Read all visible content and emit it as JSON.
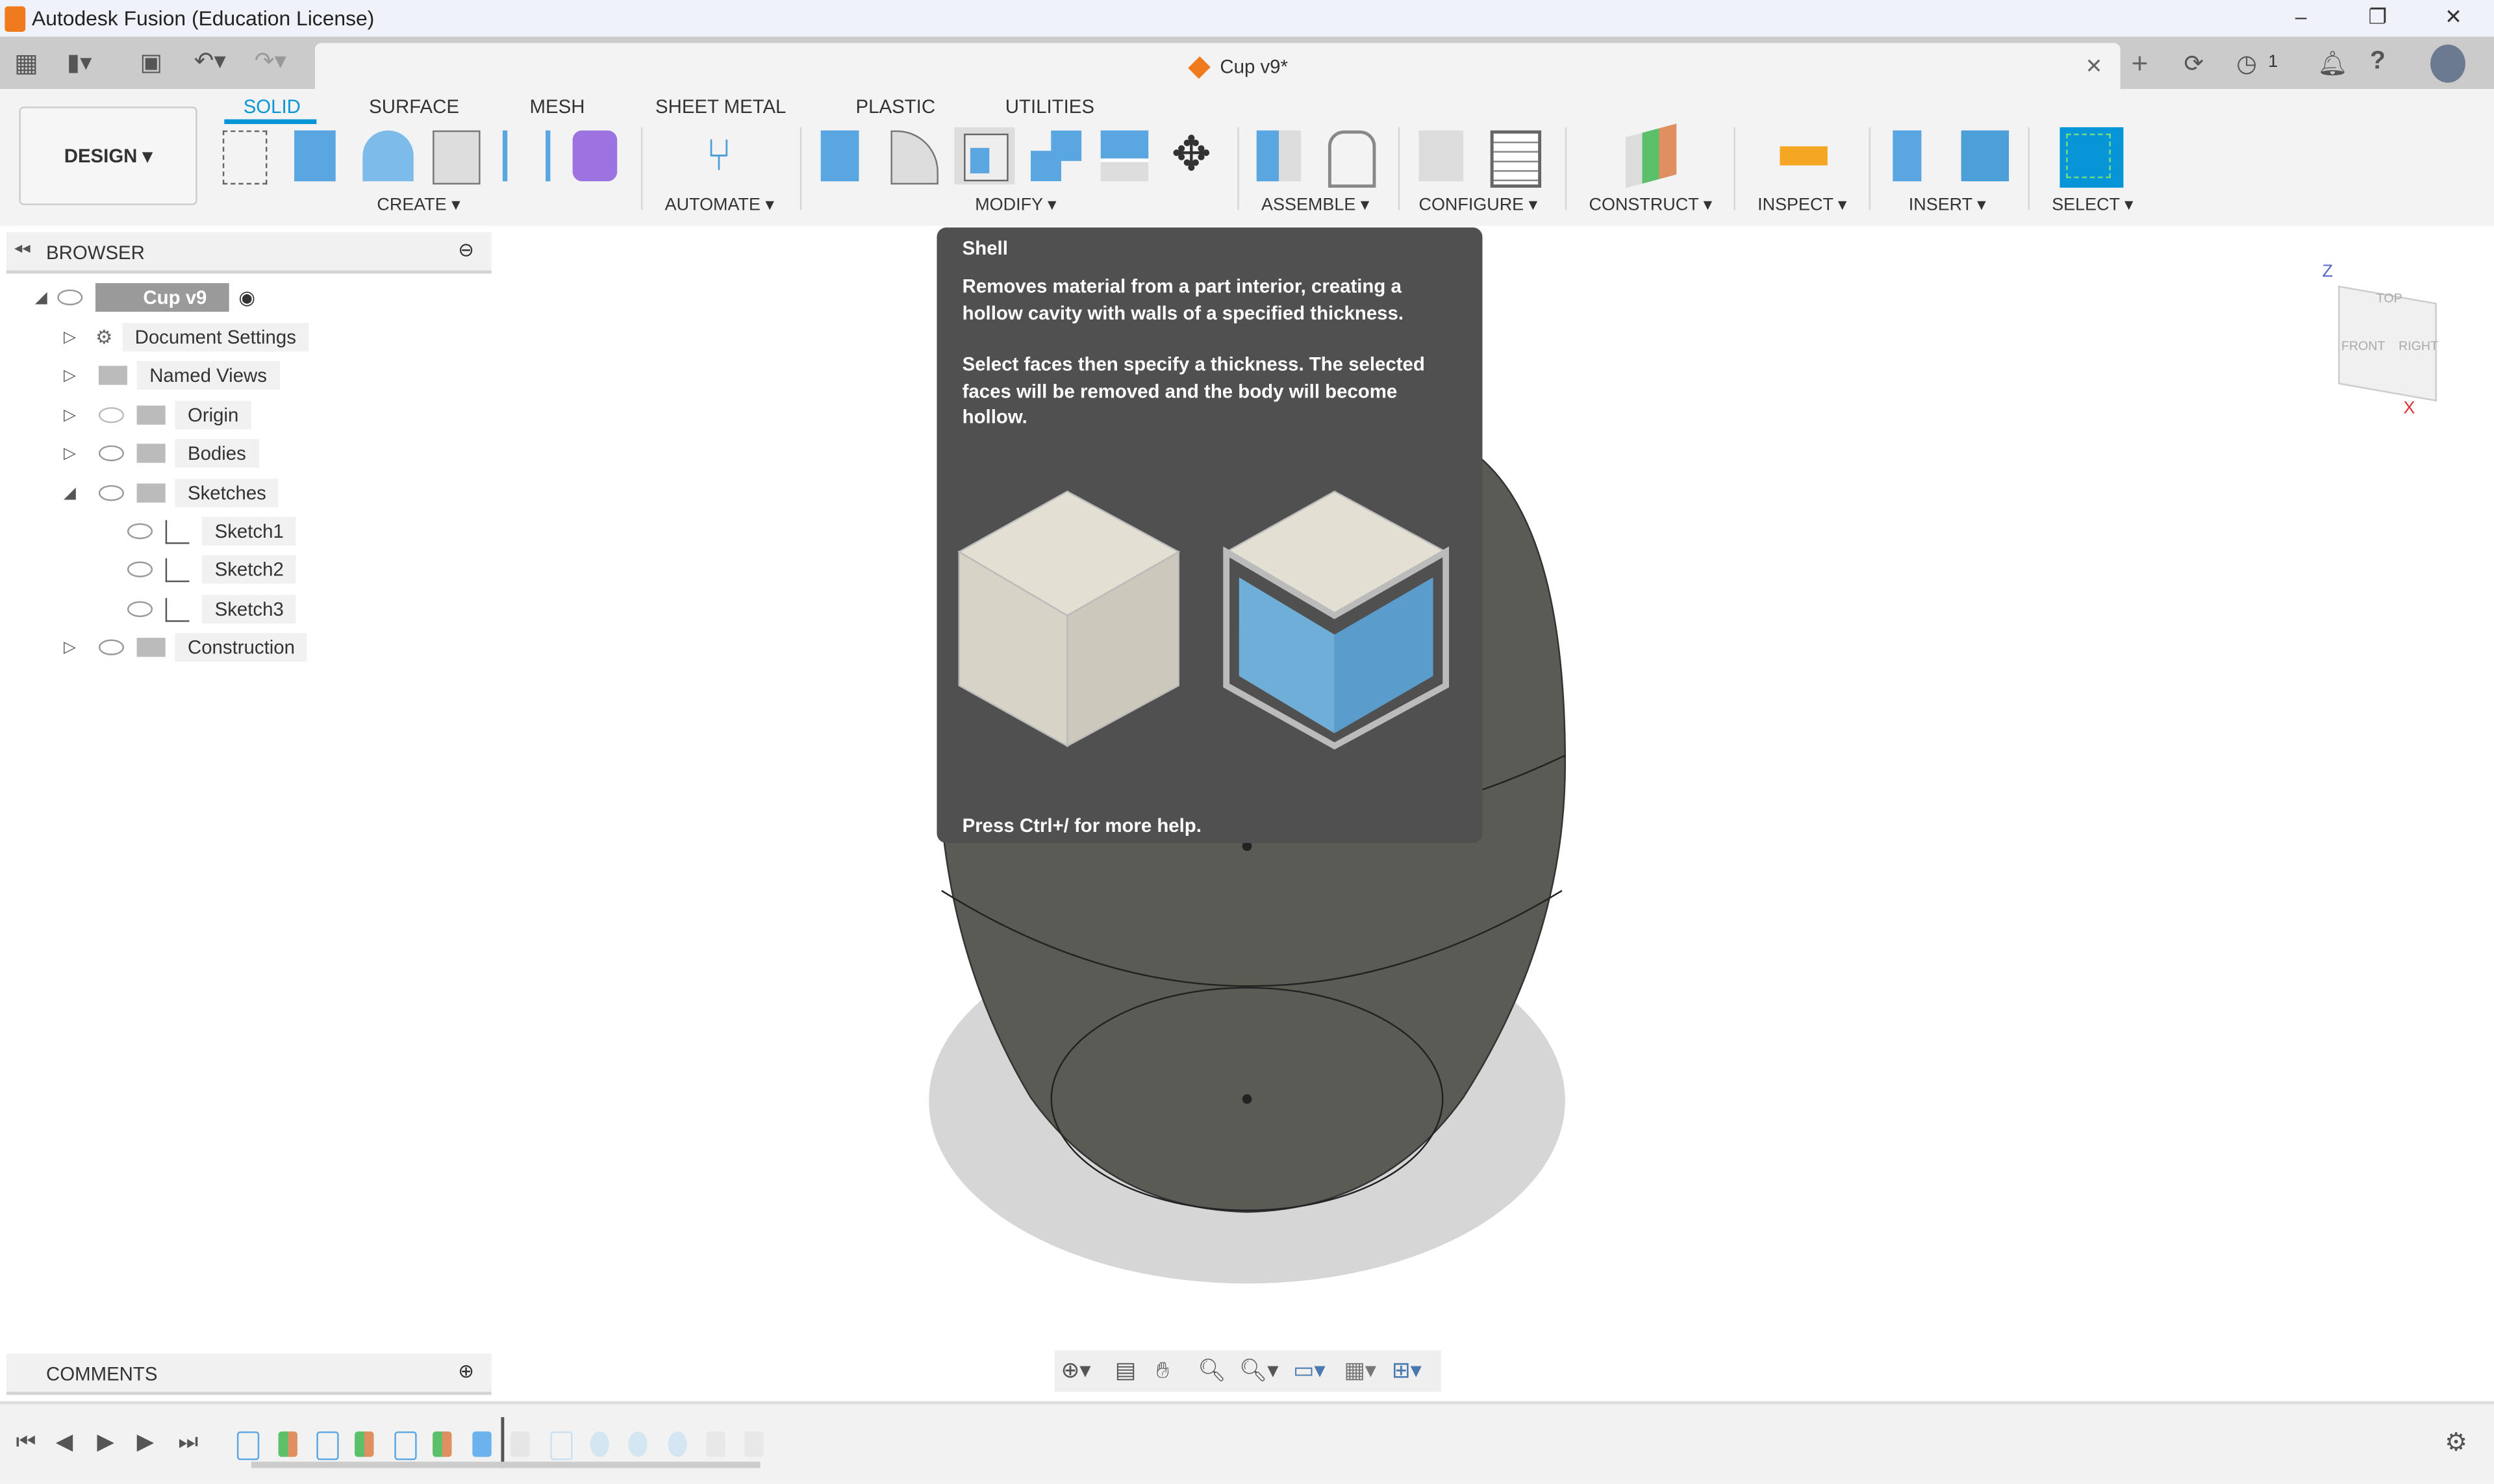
{
  "window": {
    "title": "Autodesk Fusion (Education License)",
    "minimize": "–",
    "restore": "❐",
    "close": "✕"
  },
  "document": {
    "tab_title": "Cup v9*",
    "close": "✕",
    "new_tab": "+",
    "jobs_count": "1"
  },
  "workspace": {
    "label": "DESIGN ▾"
  },
  "tabs": [
    {
      "label": "SOLID",
      "active": true
    },
    {
      "label": "SURFACE"
    },
    {
      "label": "MESH"
    },
    {
      "label": "SHEET METAL"
    },
    {
      "label": "PLASTIC"
    },
    {
      "label": "UTILITIES"
    }
  ],
  "groups": {
    "create": "CREATE ▾",
    "automate": "AUTOMATE ▾",
    "modify": "MODIFY ▾",
    "assemble": "ASSEMBLE ▾",
    "configure": "CONFIGURE ▾",
    "construct": "CONSTRUCT ▾",
    "inspect": "INSPECT ▾",
    "insert": "INSERT ▾",
    "select": "SELECT ▾"
  },
  "browser": {
    "title": "BROWSER",
    "root": "Cup v9",
    "items": [
      {
        "label": "Document Settings"
      },
      {
        "label": "Named Views"
      },
      {
        "label": "Origin"
      },
      {
        "label": "Bodies"
      },
      {
        "label": "Sketches"
      },
      {
        "label": "Sketch1"
      },
      {
        "label": "Sketch2"
      },
      {
        "label": "Sketch3"
      },
      {
        "label": "Construction"
      }
    ]
  },
  "tooltip": {
    "title": "Shell",
    "p1": "Removes material from a part interior, creating a hollow cavity with walls of a specified thickness.",
    "p2": "Select faces then specify a thickness. The selected faces will be removed and the body will become hollow.",
    "help": "Press Ctrl+/ for more help."
  },
  "viewcube": {
    "top": "TOP",
    "front": "FRONT",
    "right": "RIGHT",
    "z": "Z",
    "x": "X"
  },
  "comments": {
    "title": "COMMENTS"
  },
  "colors": {
    "accent": "#0696d7",
    "body": "#5a5a55",
    "tooltip_bg": "#505050"
  }
}
